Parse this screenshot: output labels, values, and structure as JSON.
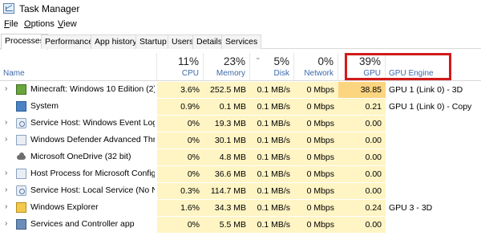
{
  "window": {
    "title": "Task Manager"
  },
  "menu": [
    "File",
    "Options",
    "View"
  ],
  "tabs": [
    "Processes",
    "Performance",
    "App history",
    "Startup",
    "Users",
    "Details",
    "Services"
  ],
  "columns": {
    "name": {
      "label": "Name"
    },
    "cpu": {
      "pct": "11%",
      "label": "CPU"
    },
    "memory": {
      "pct": "23%",
      "label": "Memory"
    },
    "disk": {
      "pct": "5%",
      "label": "Disk"
    },
    "network": {
      "pct": "0%",
      "label": "Network"
    },
    "gpu": {
      "pct": "39%",
      "label": "GPU"
    },
    "gpu_engine": {
      "label": "GPU Engine"
    }
  },
  "colors": {
    "highlight_border": "#d21a1a",
    "cell_bg": "#fff4c4",
    "gpu_high_bg": "#fcd581",
    "header_label": "#3e6aa8"
  },
  "rows": [
    {
      "name": "Minecraft: Windows 10 Edition (2)",
      "icon": "minecraft-icon",
      "expandable": true,
      "cpu": "3.6%",
      "memory": "252.5 MB",
      "disk": "0.1 MB/s",
      "network": "0 Mbps",
      "gpu": "38.85",
      "gpu_engine": "GPU 1 (Link 0) - 3D"
    },
    {
      "name": "System",
      "icon": "system-icon",
      "expandable": false,
      "cpu": "0.9%",
      "memory": "0.1 MB",
      "disk": "0.1 MB/s",
      "network": "0 Mbps",
      "gpu": "0.21",
      "gpu_engine": "GPU 1 (Link 0) - Copy"
    },
    {
      "name": "Service Host: Windows Event Log",
      "icon": "service-host-icon",
      "expandable": true,
      "cpu": "0%",
      "memory": "19.3 MB",
      "disk": "0.1 MB/s",
      "network": "0 Mbps",
      "gpu": "0.00",
      "gpu_engine": ""
    },
    {
      "name": "Windows Defender Advanced Thre...",
      "icon": "windows-defender-icon",
      "expandable": true,
      "cpu": "0%",
      "memory": "30.1 MB",
      "disk": "0.1 MB/s",
      "network": "0 Mbps",
      "gpu": "0.00",
      "gpu_engine": ""
    },
    {
      "name": "Microsoft OneDrive (32 bit)",
      "icon": "onedrive-icon",
      "expandable": false,
      "cpu": "0%",
      "memory": "4.8 MB",
      "disk": "0.1 MB/s",
      "network": "0 Mbps",
      "gpu": "0.00",
      "gpu_engine": ""
    },
    {
      "name": "Host Process for Microsoft Configu...",
      "icon": "host-process-icon",
      "expandable": true,
      "cpu": "0%",
      "memory": "36.6 MB",
      "disk": "0.1 MB/s",
      "network": "0 Mbps",
      "gpu": "0.00",
      "gpu_engine": ""
    },
    {
      "name": "Service Host: Local Service (No Net...",
      "icon": "service-host-icon",
      "expandable": true,
      "cpu": "0.3%",
      "memory": "114.7 MB",
      "disk": "0.1 MB/s",
      "network": "0 Mbps",
      "gpu": "0.00",
      "gpu_engine": ""
    },
    {
      "name": "Windows Explorer",
      "icon": "explorer-icon",
      "expandable": true,
      "cpu": "1.6%",
      "memory": "34.3 MB",
      "disk": "0.1 MB/s",
      "network": "0 Mbps",
      "gpu": "0.24",
      "gpu_engine": "GPU 3 - 3D"
    },
    {
      "name": "Services and Controller app",
      "icon": "services-icon",
      "expandable": true,
      "cpu": "0%",
      "memory": "5.5 MB",
      "disk": "0.1 MB/s",
      "network": "0 Mbps",
      "gpu": "0.00",
      "gpu_engine": ""
    }
  ]
}
